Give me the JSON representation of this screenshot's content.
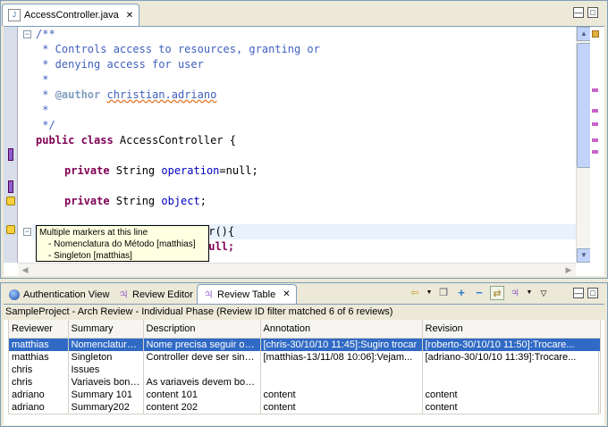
{
  "editor": {
    "tab_label": "AccessController.java",
    "tab_close": "✕",
    "code": {
      "l1": "/**",
      "l2": " * Controls access to resources, granting or",
      "l3": " * denying access for user",
      "l4": " *",
      "l5_prefix": " * ",
      "l5_tag": "@author",
      "l5_sp": " ",
      "l5_name": "christian.adriano",
      "l6": " *",
      "l7": " */",
      "l8_kw": "public class",
      "l8_rest": " AccessController {",
      "l9_kw": "private",
      "l9_type": " String ",
      "l9_field": "operation",
      "l9_rest": "=null;",
      "l10_kw": "private",
      "l10_type": " String ",
      "l10_field": "object",
      "l10_rest": ";",
      "l11_tail": "er(){",
      "l12_tail": "null;"
    },
    "tooltip": {
      "title": "Multiple markers at this line",
      "item1": "- Nomenclatura do Método [matthias]",
      "item2": "- Singleton [matthias]"
    }
  },
  "views": {
    "tabs": [
      {
        "label": "Authentication View"
      },
      {
        "label": "Review Editor"
      },
      {
        "label": "Review Table"
      }
    ],
    "close": "✕",
    "status": "SampleProject - Arch Review - Individual Phase (Review ID filter matched 6 of 6 reviews)"
  },
  "table": {
    "headers": [
      "Reviewer",
      "Summary",
      "Description",
      "Annotation",
      "Revision"
    ],
    "rows": [
      [
        "matthias",
        "Nomenclatura do Método",
        "Nome precisa seguir o padrão",
        "[chris-30/10/10 11:45]:Sugiro trocar",
        "[roberto-30/10/10 11:50]:Trocare..."
      ],
      [
        "matthias",
        "Singleton",
        "Controller deve ser singleton",
        "[matthias-13/11/08 10:06]:Vejam...",
        "[adriano-30/10/10 11:39]:Trocare..."
      ],
      [
        "chris",
        "Issues",
        "",
        "",
        ""
      ],
      [
        "chris",
        "Variaveis bonitas",
        "As variaveis devem bonitas",
        "",
        ""
      ],
      [
        "adriano",
        "Summary 101",
        "content 101",
        "content",
        "content"
      ],
      [
        "adriano",
        "Summary202",
        "content 202",
        "content",
        "content"
      ]
    ]
  },
  "colors": {
    "selection": "#316ac5",
    "comment": "#3f5fbf",
    "keyword": "#7f0055",
    "field": "#0000c0"
  }
}
